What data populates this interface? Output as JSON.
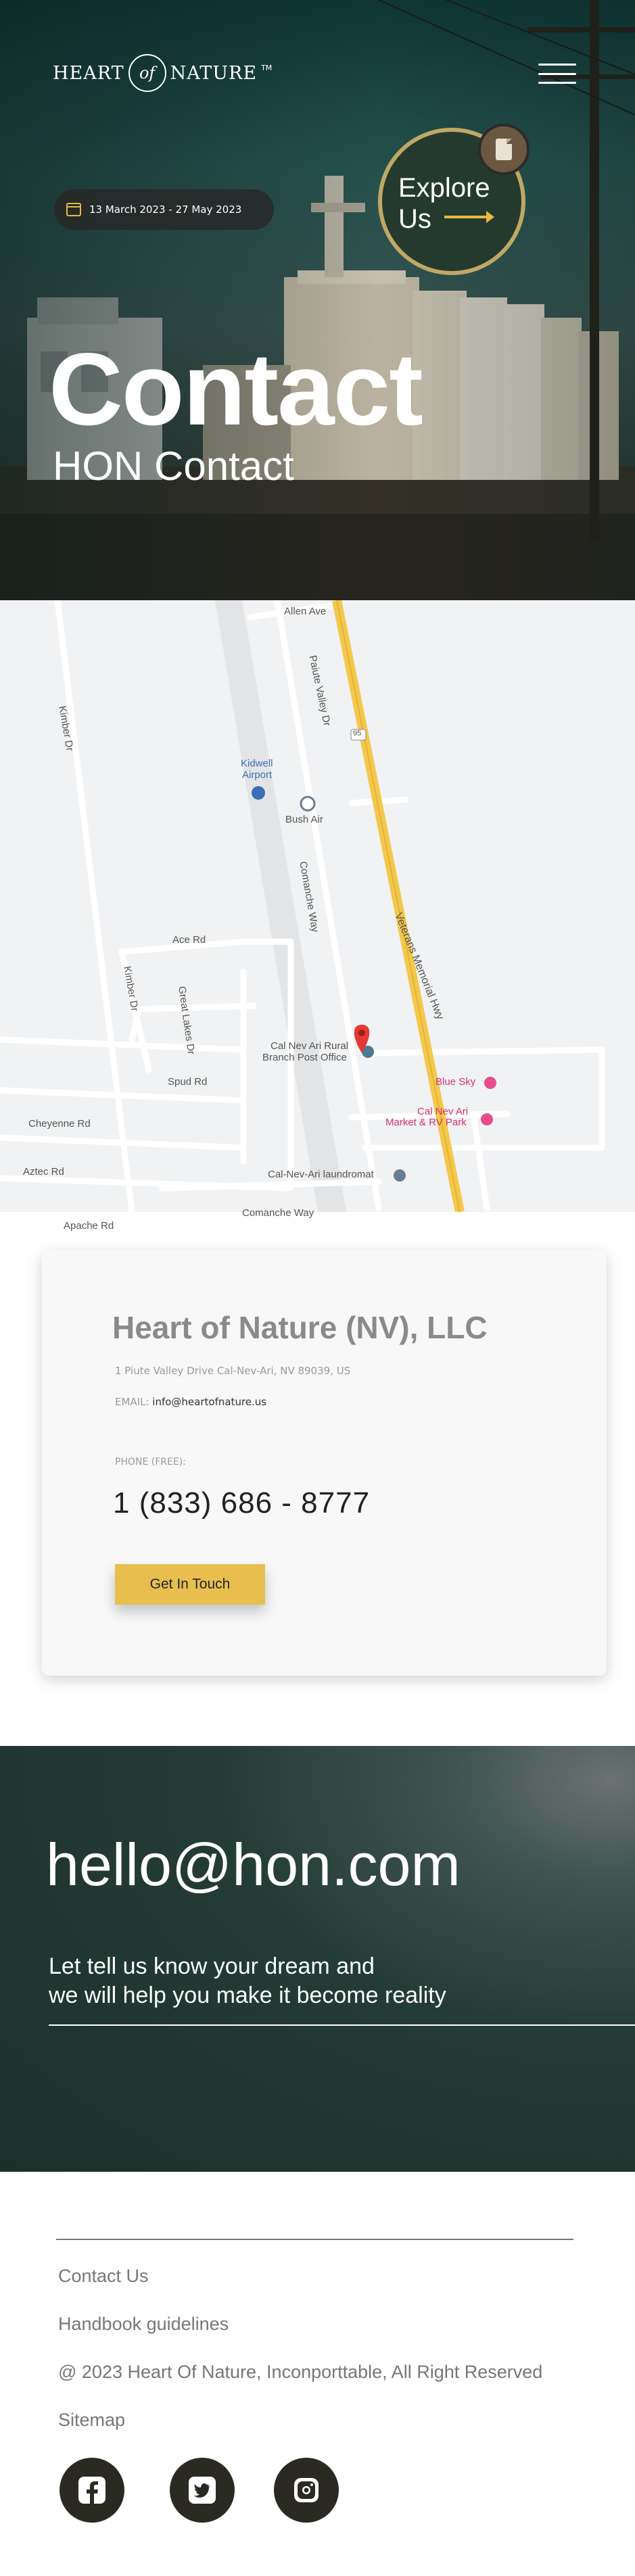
{
  "brand": {
    "logo_left": "HEART",
    "logo_mid": "of",
    "logo_right": "NATURE",
    "tm": "TM"
  },
  "hero": {
    "date_range": "13 March 2023 - 27 May 2023",
    "explore_line1": "Explore",
    "explore_line2": "Us",
    "title": "Contact",
    "subtitle": "HON Contact"
  },
  "map": {
    "labels": {
      "allen": "Allen Ave",
      "kimber": "Kimber Dr",
      "paiute": "Paiute Valley Dr",
      "kidwell1": "Kidwell",
      "kidwell2": "Airport",
      "bushair": "Bush Air",
      "comanche": "Comanche Way",
      "veterans": "Veterans Memorial Hwy",
      "hwy": "95",
      "ace": "Ace Rd",
      "kimber2": "Kimber Dr",
      "great_lakes": "Great Lakes Dr",
      "spud": "Spud Rd",
      "cheyenne": "Cheyenne Rd",
      "aztec": "Aztec Rd",
      "apache": "Apache Rd",
      "comanche2": "Comanche Way",
      "post1": "Cal Nev Ari Rural",
      "post2": "Branch Post Office",
      "bluesky": "Blue Sky",
      "market1": "Cal Nev Ari",
      "market2": "Market & RV Park",
      "laundromat": "Cal-Nev-Ari laundromat"
    }
  },
  "contact": {
    "company": "Heart of Nature (NV), LLC",
    "address": "1 Piute Valley Drive Cal-Nev-Ari, NV 89039, US",
    "email_label": "EMAIL:",
    "email": "info@heartofnature.us",
    "phone_label": "PHONE (FREE):",
    "phone": "1 (833) 686 - 8777",
    "cta": "Get In Touch"
  },
  "banner": {
    "email": "hello@hon.com",
    "line1": "Let tell us know your dream and",
    "line2": "we will help you make it become reality"
  },
  "footer": {
    "links": [
      "Contact Us",
      "Handbook guidelines",
      "@ 2023 Heart Of Nature, Inconporttable, All Right Reserved",
      "Sitemap"
    ],
    "social": [
      "facebook-icon",
      "twitter-icon",
      "instagram-icon"
    ]
  },
  "colors": {
    "accent": "#e8bf4e",
    "dark_green": "#1c302b",
    "social_bg": "#2b2a22",
    "map_highway": "#f3c84b",
    "map_pin": "#e53935"
  }
}
